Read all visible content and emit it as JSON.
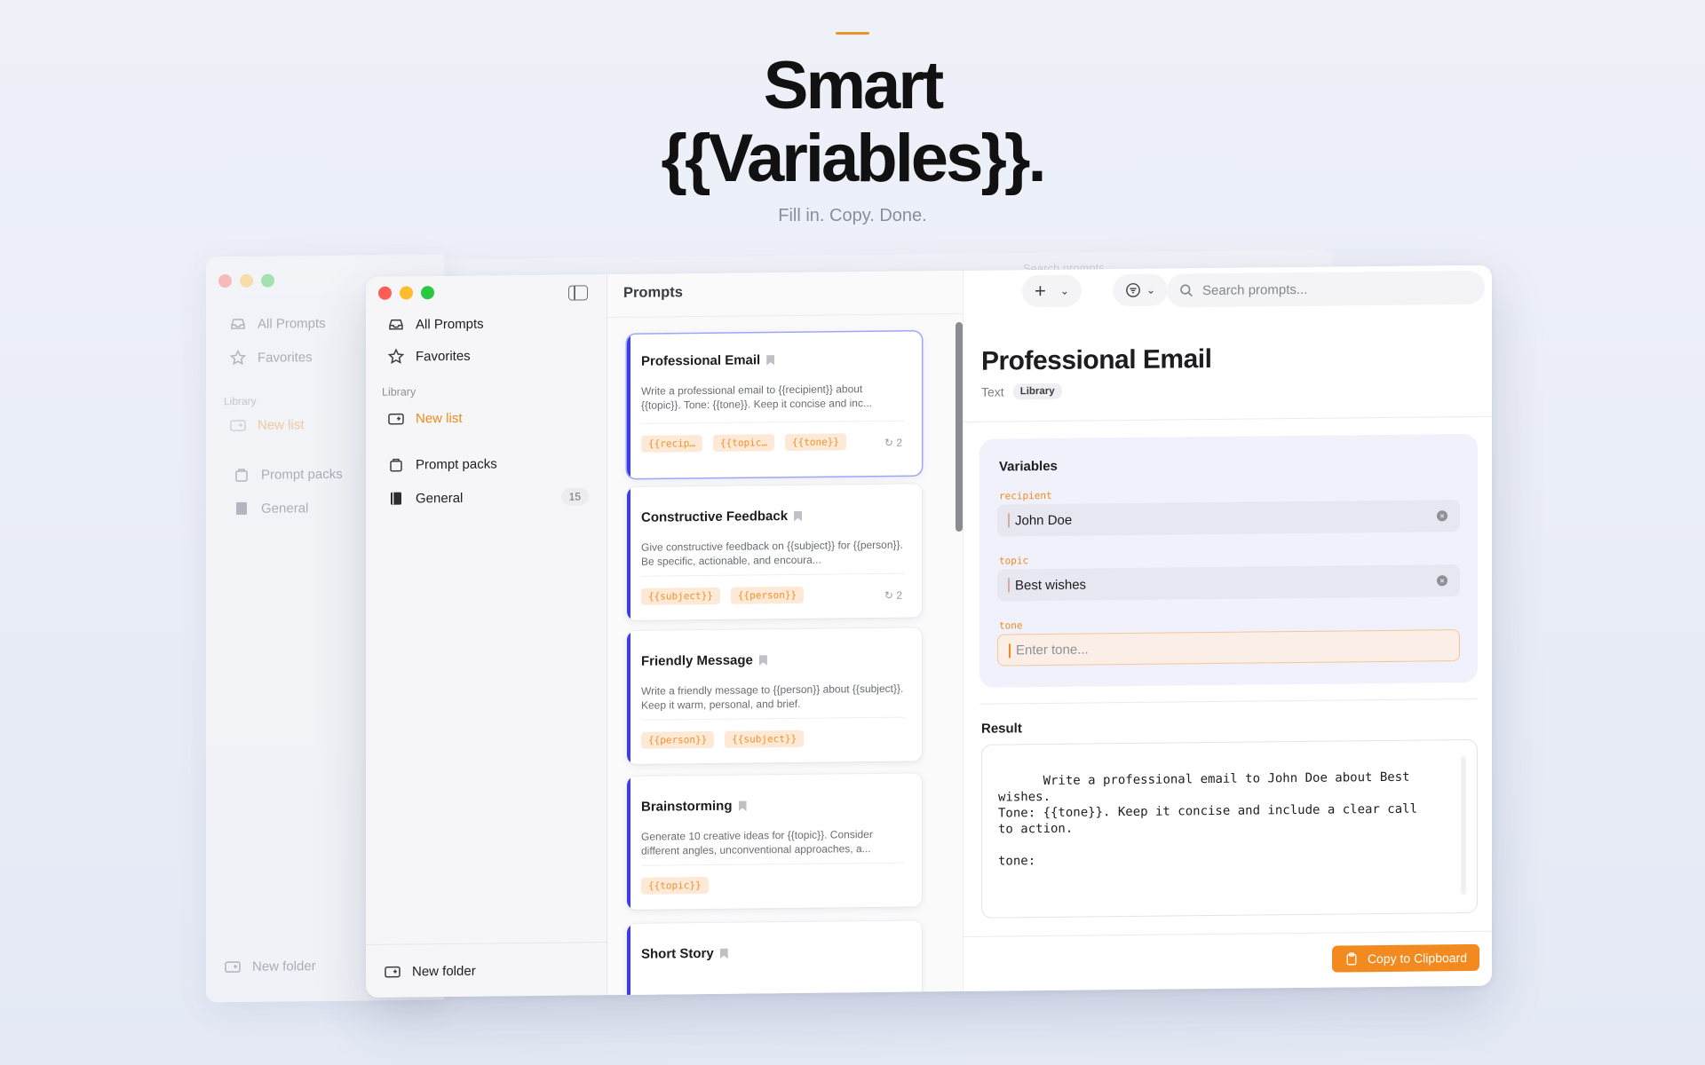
{
  "hero": {
    "title_line1": "Smart",
    "title_line2": "{{Variables}}.",
    "subtitle": "Fill in. Copy. Done."
  },
  "back_window": {
    "items": [
      "All Prompts",
      "Favorites"
    ],
    "library_label": "Library",
    "new_list": "New list",
    "packs": [
      "Prompt packs",
      "General"
    ],
    "new_folder": "New folder",
    "search_placeholder": "Search prompts..."
  },
  "sidebar": {
    "items": [
      {
        "label": "All Prompts",
        "icon": "tray-icon"
      },
      {
        "label": "Favorites",
        "icon": "star-icon"
      }
    ],
    "library_label": "Library",
    "new_list": "New list",
    "prompt_packs": "Prompt packs",
    "general": "General",
    "general_count": "15",
    "new_folder": "New folder"
  },
  "list": {
    "title": "Prompts",
    "cards": [
      {
        "title": "Professional Email",
        "desc": "Write a professional email to {{recipient}} about {{topic}}. Tone: {{tone}}. Keep it concise and inc...",
        "tags": [
          "{{recip…",
          "{{topic…",
          "{{tone}}"
        ],
        "count": "2"
      },
      {
        "title": "Constructive Feedback",
        "desc": "Give constructive feedback on {{subject}} for {{person}}. Be specific, actionable, and encoura...",
        "tags": [
          "{{subject}}",
          "{{person}}"
        ],
        "count": "2"
      },
      {
        "title": "Friendly Message",
        "desc": "Write a friendly message to {{person}} about {{subject}}. Keep it warm, personal, and brief.",
        "tags": [
          "{{person}}",
          "{{subject}}"
        ],
        "count": ""
      },
      {
        "title": "Brainstorming",
        "desc": "Generate 10 creative ideas for {{topic}}. Consider different angles, unconventional approaches, a...",
        "tags": [
          "{{topic}}"
        ],
        "count": ""
      },
      {
        "title": "Short Story",
        "desc": "",
        "tags": [],
        "count": ""
      }
    ]
  },
  "detail": {
    "search_placeholder": "Search prompts...",
    "title": "Professional Email",
    "type": "Text",
    "badge": "Library",
    "variables_title": "Variables",
    "variables": [
      {
        "name": "recipient",
        "value": "John Doe"
      },
      {
        "name": "topic",
        "value": "Best wishes"
      },
      {
        "name": "tone",
        "placeholder": "Enter tone..."
      }
    ],
    "result_label": "Result",
    "result_text": "Write a professional email to John Doe about Best wishes.\nTone: {{tone}}. Keep it concise and include a clear call\nto action.\n\ntone:",
    "copy_label": "Copy to Clipboard"
  },
  "colors": {
    "accent": "#f28a1f",
    "selection": "#3d3de0"
  }
}
